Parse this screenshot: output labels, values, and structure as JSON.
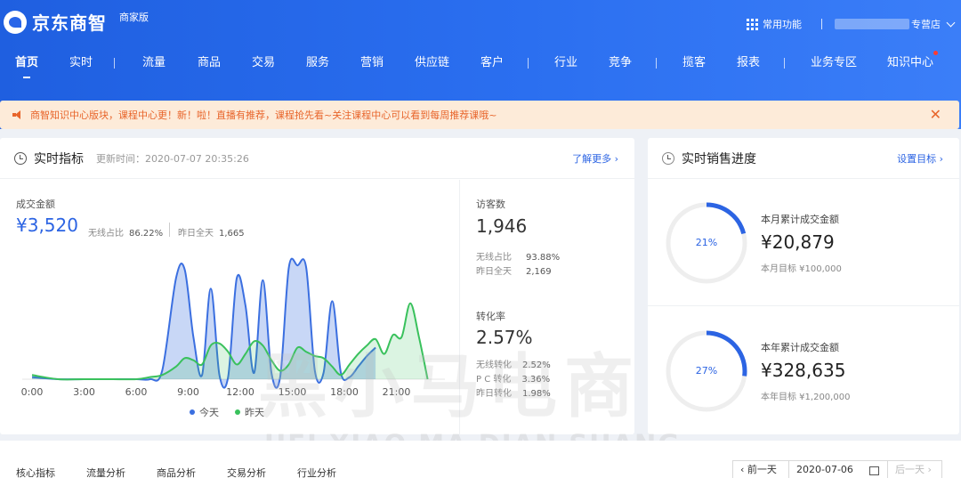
{
  "header": {
    "brand": "京东商智",
    "badge": "商家版",
    "common_functions": "常用功能",
    "shop_name": "专营店"
  },
  "nav": [
    "首页",
    "实时",
    "流量",
    "商品",
    "交易",
    "服务",
    "营销",
    "供应链",
    "客户",
    "行业",
    "竞争",
    "揽客",
    "报表",
    "业务专区",
    "知识中心"
  ],
  "notice": "商智知识中心版块，课程中心更！新！啦！直播有推荐，课程抢先看~关注课程中心可以看到每周推荐课哦~",
  "realtime": {
    "title": "实时指标",
    "update_time": "更新时间：2020-07-07 20:35:26",
    "more_link": "了解更多",
    "gmv_label": "成交金额",
    "gmv_value": "¥3,520",
    "wireless_share_label": "无线占比",
    "wireless_share_value": "86.22%",
    "yesterday_label": "昨日全天",
    "yesterday_value": "1,665",
    "visitors_label": "访客数",
    "visitors_value": "1,946",
    "visitors_wireless_label": "无线占比",
    "visitors_wireless_value": "93.88%",
    "visitors_yesterday_label": "昨日全天",
    "visitors_yesterday_value": "2,169",
    "conv_label": "转化率",
    "conv_value": "2.57%",
    "conv_wireless_label": "无线转化",
    "conv_wireless_value": "2.52%",
    "conv_pc_label": "P C 转化",
    "conv_pc_value": "3.36%",
    "conv_yesterday_label": "昨日转化",
    "conv_yesterday_value": "1.98%"
  },
  "chart_data": {
    "type": "area",
    "x_ticks": [
      "0:00",
      "3:00",
      "6:00",
      "9:00",
      "12:00",
      "15:00",
      "18:00",
      "21:00"
    ],
    "x": [
      0,
      1.5,
      3,
      4.5,
      6,
      6.8,
      7.5,
      8.3,
      8.8,
      9.3,
      9.8,
      10.3,
      10.8,
      11.3,
      11.8,
      12.3,
      12.8,
      13.3,
      13.8,
      14.3,
      14.8,
      15.3,
      15.8,
      16.3,
      16.8,
      17.3,
      17.8,
      18.3,
      18.8,
      19.3,
      19.8
    ],
    "series": [
      {
        "name": "今天",
        "color": "#3b6fe0",
        "values": [
          0.1,
          0,
          0,
          0,
          0,
          0,
          0.4,
          4.8,
          5.2,
          2,
          0.2,
          4.3,
          0.2,
          0.1,
          4.8,
          3.5,
          0.3,
          4.7,
          0.3,
          0.1,
          5.3,
          5.4,
          5.3,
          0.4,
          0.3,
          3.7,
          0.3,
          0.1,
          0.6,
          1.1,
          1.5
        ]
      },
      {
        "name": "昨天",
        "color": "#39c15c",
        "values": [
          0.2,
          0,
          0,
          0,
          0,
          0.1,
          0.2,
          0.6,
          1,
          0.9,
          0.7,
          1.6,
          1.7,
          1.3,
          0.7,
          1.2,
          1.8,
          1.6,
          0.9,
          0.4,
          0.7,
          1.5,
          1.3,
          1.1,
          1,
          0.6,
          0.2,
          0.7,
          1.2,
          1.6,
          1.9
        ]
      }
    ],
    "extra_points_yesterday": [
      [
        20.3,
        1.2
      ],
      [
        20.8,
        2.1
      ],
      [
        21.3,
        2.0
      ],
      [
        21.8,
        3.6
      ],
      [
        22.3,
        2.0
      ],
      [
        22.8,
        0
      ]
    ],
    "xlim": [
      0,
      24
    ],
    "ylim": [
      0,
      6
    ],
    "legend": "bottom"
  },
  "sales": {
    "title": "实时销售进度",
    "set_target": "设置目标",
    "month": {
      "percent": "21%",
      "fraction": 0.21,
      "label": "本月累计成交金额",
      "value": "¥20,879",
      "target": "本月目标 ¥100,000"
    },
    "year": {
      "percent": "27%",
      "fraction": 0.27,
      "label": "本年累计成交金额",
      "value": "¥328,635",
      "target": "本年目标 ¥1,200,000"
    }
  },
  "bottom": {
    "tabs": [
      "核心指标",
      "流量分析",
      "商品分析",
      "交易分析",
      "行业分析"
    ],
    "prev_day": "前一天",
    "date": "2020-07-06",
    "next_day": "后一天"
  },
  "watermark": {
    "cn": "黑小马电商",
    "en": "HEI XIAO MA DIAN SHANG"
  },
  "colors": {
    "primary": "#2b6ff0",
    "today": "#3b6fe0",
    "yesterday": "#39c15c",
    "notice": "#e8652b"
  }
}
